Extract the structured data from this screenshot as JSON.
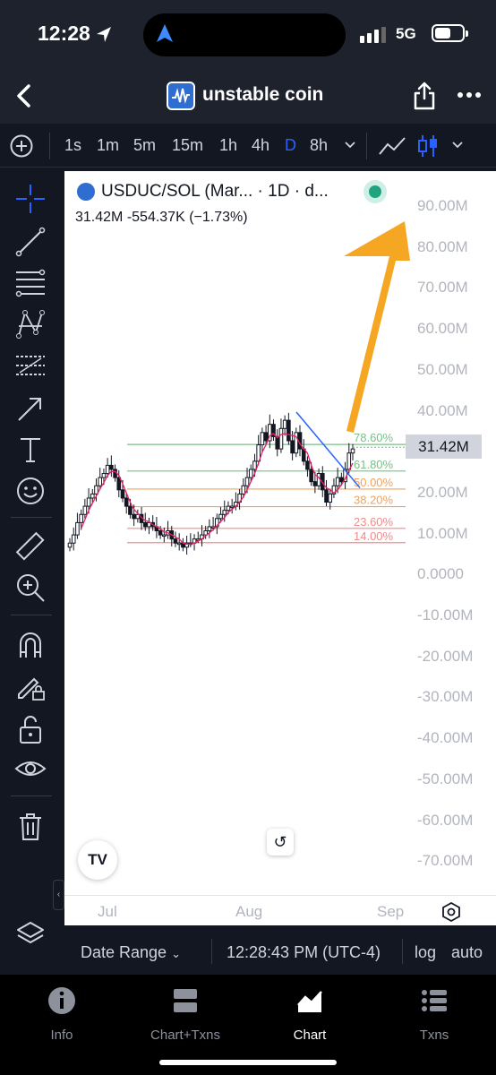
{
  "status_bar": {
    "time": "12:28",
    "network": "5G"
  },
  "header": {
    "title": "unstable coin"
  },
  "timeframes": [
    "1s",
    "1m",
    "5m",
    "15m",
    "1h",
    "4h",
    "D",
    "8h"
  ],
  "selected_timeframe": "D",
  "chart": {
    "symbol": "USDUC/SOL (Mar...",
    "interval_label": "· 1D · d...",
    "ohlc_summary": "31.42M  -554.37K (−1.73%)",
    "last_price": "31.42M",
    "price_ticks": [
      "90.00M",
      "80.00M",
      "70.00M",
      "60.00M",
      "50.00M",
      "40.00M",
      "30.00M",
      "20.00M",
      "10.00M",
      "0.0000",
      "-10.00M",
      "-20.00M",
      "-30.00M",
      "-40.00M",
      "-50.00M",
      "-60.00M",
      "-70.00M"
    ],
    "time_ticks": [
      "Jul",
      "Aug",
      "Sep"
    ],
    "fib_labels": [
      "78.60%",
      "61.80%",
      "50.00%",
      "38.20%",
      "23.60%",
      "14.00%"
    ],
    "colors": {
      "up": "#131722",
      "fib_green": "#7bbf88",
      "fib_orange": "#f0a35e",
      "fib_red": "#f28b8b",
      "trend": "#2962ff",
      "arrow": "#f5a623",
      "ma": "#e91e63"
    }
  },
  "bottom_bar": {
    "date_range": "Date Range",
    "clock": "12:28:43 PM (UTC-4)",
    "log": "log",
    "auto": "auto"
  },
  "nav": [
    {
      "label": "Info",
      "icon": "info-icon"
    },
    {
      "label": "Chart+Txns",
      "icon": "chart-txns-icon"
    },
    {
      "label": "Chart",
      "icon": "chart-icon"
    },
    {
      "label": "Txns",
      "icon": "list-icon"
    }
  ],
  "active_nav": "Chart"
}
